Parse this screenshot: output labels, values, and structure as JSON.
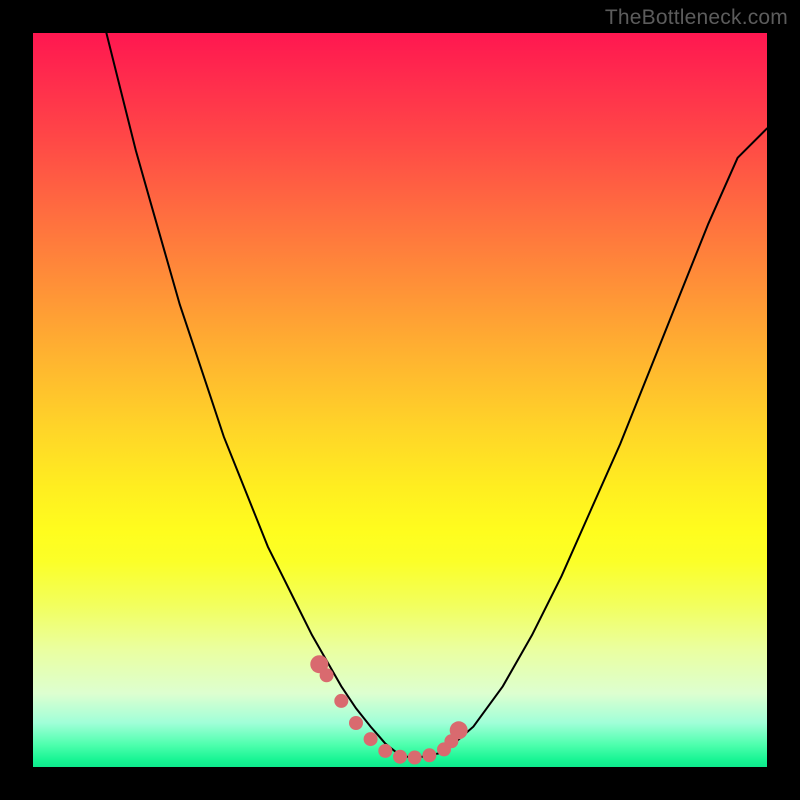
{
  "watermark": "TheBottleneck.com",
  "chart_data": {
    "type": "line",
    "title": "",
    "xlabel": "",
    "ylabel": "",
    "xlim": [
      0,
      100
    ],
    "ylim": [
      0,
      100
    ],
    "series": [
      {
        "name": "curve",
        "x": [
          10,
          12,
          14,
          16,
          18,
          20,
          22,
          24,
          26,
          28,
          30,
          32,
          34,
          36,
          38,
          40,
          42,
          44,
          46,
          48,
          50,
          52,
          56,
          60,
          64,
          68,
          72,
          76,
          80,
          84,
          88,
          92,
          96,
          100
        ],
        "values": [
          100,
          92,
          84,
          77,
          70,
          63,
          57,
          51,
          45,
          40,
          35,
          30,
          26,
          22,
          18,
          14.5,
          11,
          8,
          5.5,
          3.2,
          1.6,
          1.2,
          2.0,
          5.5,
          11,
          18,
          26,
          35,
          44,
          54,
          64,
          74,
          83,
          87
        ]
      },
      {
        "name": "highlight-dots",
        "x": [
          39,
          40,
          42,
          44,
          46,
          48,
          50,
          52,
          54,
          56,
          57,
          58
        ],
        "values": [
          14,
          12.5,
          9,
          6,
          3.8,
          2.2,
          1.4,
          1.3,
          1.6,
          2.4,
          3.5,
          5
        ]
      }
    ],
    "colors": {
      "curve": "#000000",
      "dots": "#d96a6f",
      "background_gradient_top": "#ff1750",
      "background_gradient_bottom": "#0ee98d"
    }
  }
}
